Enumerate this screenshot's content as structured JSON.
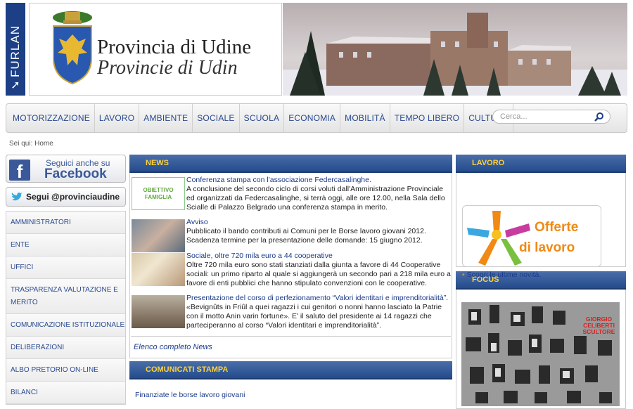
{
  "header": {
    "furlan_label": "FURLAN",
    "title_it": "Provincia di Udine",
    "title_fur": "Provincie di Udin"
  },
  "nav": {
    "items": [
      "MOTORIZZAZIONE",
      "LAVORO",
      "AMBIENTE",
      "SOCIALE",
      "SCUOLA",
      "ECONOMIA",
      "MOBILITÀ",
      "TEMPO LIBERO",
      "CULTURA"
    ],
    "search_placeholder": "Cerca..."
  },
  "breadcrumb": "Sei qui: Home",
  "social": {
    "facebook_line1": "Seguici anche su",
    "facebook_line2": "Facebook",
    "twitter": "Segui @provinciaudine"
  },
  "sidebar": {
    "items": [
      "AMMINISTRATORI",
      "ENTE",
      "UFFICI",
      "TRASPARENZA VALUTAZIONE E MERITO",
      "COMUNICAZIONE ISTITUZIONALE",
      "DELIBERAZIONI",
      "ALBO PRETORIO ON-LINE",
      "BILANCI"
    ]
  },
  "news": {
    "header": "NEWS",
    "items": [
      {
        "title": "Conferenza stampa con l'associazione Federcasalinghe.",
        "body": "A conclusione del secondo ciclo di corsi voluti dall'Amministrazione Provinciale ed organizzati da Federcasalinghe, si terrà oggi, alle ore 12.00, nella Sala dello Scialle di Palazzo Belgrado una conferenza stampa in merito.",
        "thumb_text": "OBIETTIVO FAMIGLIA"
      },
      {
        "title": "Avviso",
        "body": "Pubblicato il bando contributi ai Comuni per le Borse lavoro giovani 2012. Scadenza termine per la presentazione delle domande: 15 giugno 2012."
      },
      {
        "title": "Sociale, oltre 720 mila euro a 44 cooperative",
        "body": "Oltre 720 mila euro sono stati stanziati dalla giunta a favore di 44 Cooperative sociali: un primo riparto al quale si aggiungerà un secondo pari a 218 mila euro a favore di enti pubblici che hanno stipulato convenzioni con le cooperative."
      },
      {
        "title": "Presentazione del corso di perfezionamento “Valori identitari e imprenditorialità”.",
        "body": "«Bevignûts in Friûl a quei ragazzi i cui genitori o nonni hanno lasciato la Patrie con il motto Anin varin fortune». E' il saluto del presidente ai 14 ragazzi che parteciperanno al corso “Valori identitari e imprenditorialità”."
      }
    ],
    "all_link": "Elenco completo News"
  },
  "comunicati": {
    "header": "COMUNICATI STAMPA",
    "first": "Finanziate le borse lavoro giovani"
  },
  "lavoro": {
    "header": "LAVORO",
    "offerte_line1": "Offerte",
    "offerte_line2": "di lavoro",
    "scopri": "Scopri le ultime novità."
  },
  "focus": {
    "header": "FOCUS",
    "image_label": "GIORGIO CELIBERTI SCULTORE"
  },
  "colors": {
    "brand_blue": "#244b8c",
    "header_text": "#ffd23c",
    "link": "#1a3a8a",
    "offerte_orange": "#f08a14"
  }
}
